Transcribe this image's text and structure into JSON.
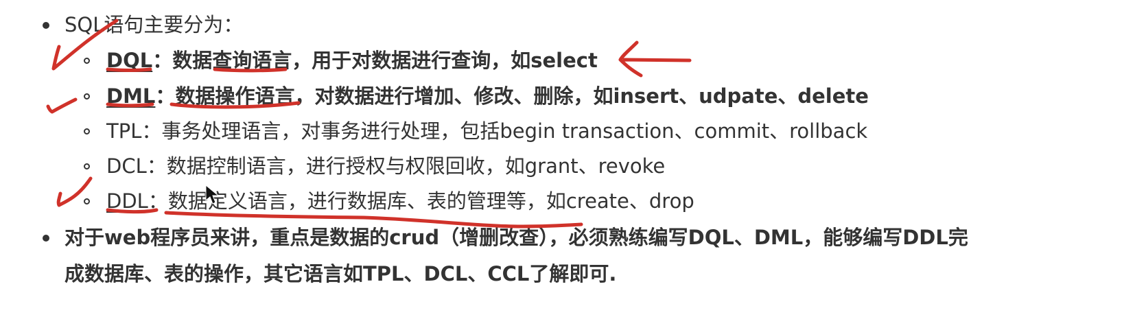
{
  "colors": {
    "text": "#333333",
    "annotation": "#d0322a"
  },
  "items": {
    "sql_intro": {
      "text": "SQL语句主要分为："
    },
    "dql": {
      "term": "DQL",
      "sep": "：",
      "desc": "数据查询语言，用于对数据进行查询，如select"
    },
    "dml": {
      "term": "DML",
      "sep": "：",
      "desc": "数据操作语言，对数据进行增加、修改、删除，如insert、udpate、delete"
    },
    "tpl": {
      "term": "TPL",
      "sep": "：",
      "desc": "事务处理语言，对事务进行处理，包括begin transaction、commit、rollback"
    },
    "dcl": {
      "term": "DCL",
      "sep": "：",
      "desc": "数据控制语言，进行授权与权限回收，如grant、revoke"
    },
    "ddl": {
      "term": "DDL",
      "sep": "：",
      "desc": "数据定义语言，进行数据库、表的管理等，如create、drop"
    },
    "web_note": {
      "line1": "对于web程序员来讲，重点是数据的crud（增删改查），必须熟练编写DQL、DML，能够编写DDL完",
      "line2": "成数据库、表的操作，其它语言如TPL、DCL、CCL了解即可."
    }
  },
  "annotations": [
    "checkmark-icon",
    "arrow-left-icon",
    "underline-mark",
    "mouse-cursor-icon"
  ]
}
